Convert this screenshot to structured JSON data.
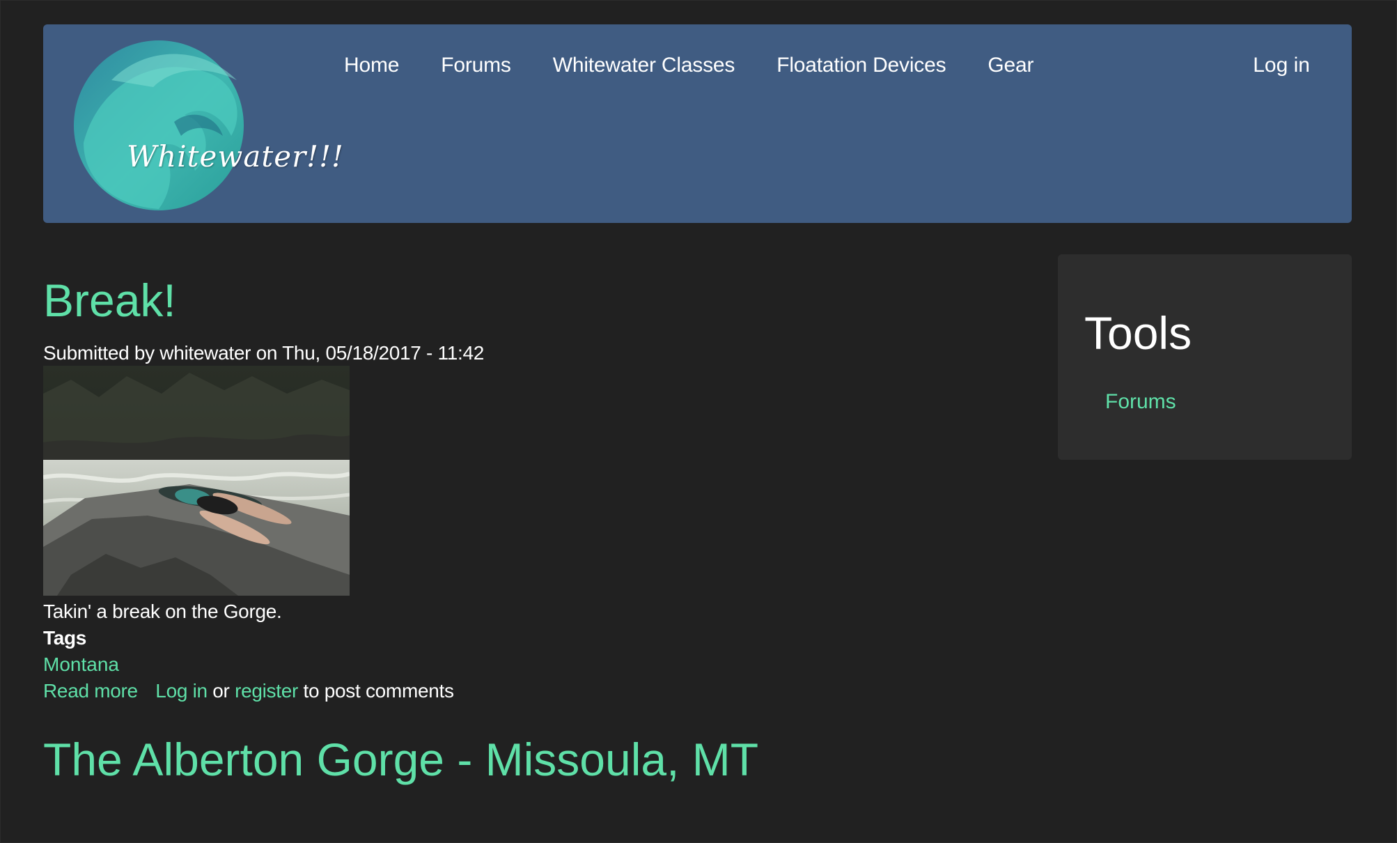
{
  "header": {
    "logo_text": "Whitewater!!!",
    "nav": [
      {
        "label": "Home"
      },
      {
        "label": "Forums"
      },
      {
        "label": "Whitewater Classes"
      },
      {
        "label": "Floatation Devices"
      },
      {
        "label": "Gear"
      }
    ],
    "login_label": "Log in"
  },
  "nodes": [
    {
      "title": "Break!",
      "submitted": "Submitted by whitewater on Thu, 05/18/2017 - 11:42",
      "body": "Takin' a break on the Gorge.",
      "tags_label": "Tags",
      "tags": [
        "Montana"
      ],
      "read_more": "Read more",
      "login": "Log in",
      "or": "or",
      "register": "register",
      "post_comments": "to post comments"
    },
    {
      "title": "The Alberton Gorge - Missoula, MT"
    }
  ],
  "sidebar": {
    "title": "Tools",
    "links": [
      {
        "label": "Forums"
      }
    ]
  },
  "colors": {
    "background": "#212121",
    "header": "#405c82",
    "accent": "#5fe0a8",
    "sidebar": "#2d2d2d"
  }
}
